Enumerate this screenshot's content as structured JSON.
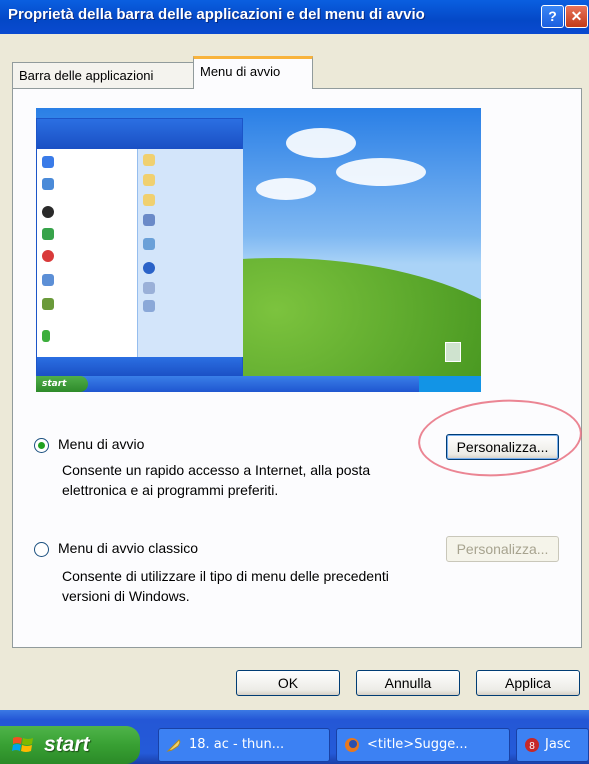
{
  "window": {
    "title": "Proprietà della barra delle applicazioni e del menu di avvio",
    "help_glyph": "?",
    "close_glyph": "✕"
  },
  "tabs": [
    {
      "label": "Barra delle applicazioni",
      "selected": false
    },
    {
      "label": "Menu di avvio",
      "selected": true
    }
  ],
  "options": {
    "startmenu": {
      "label": "Menu di avvio",
      "description": "Consente un rapido accesso a Internet, alla posta elettronica e ai programmi preferiti.",
      "selected": true,
      "customize_label": "Personalizza..."
    },
    "classic": {
      "label": "Menu di avvio classico",
      "description": "Consente di utilizzare il tipo di menu delle precedenti versioni di Windows.",
      "selected": false,
      "customize_label": "Personalizza..."
    }
  },
  "buttons": {
    "ok": "OK",
    "cancel": "Annulla",
    "apply": "Applica"
  },
  "preview": {
    "start_label": "start"
  },
  "taskbar": {
    "start_label": "start",
    "items": [
      {
        "label": "18. ac - thun...",
        "icon": "feather-icon"
      },
      {
        "label": "<title>Sugge...",
        "icon": "firefox-icon"
      },
      {
        "label": "Jasc",
        "icon": "jasc-icon"
      }
    ]
  },
  "colors": {
    "title_blue": "#0448c7",
    "radio_selected": "#21a121",
    "annotation_circle": "#e87080"
  }
}
